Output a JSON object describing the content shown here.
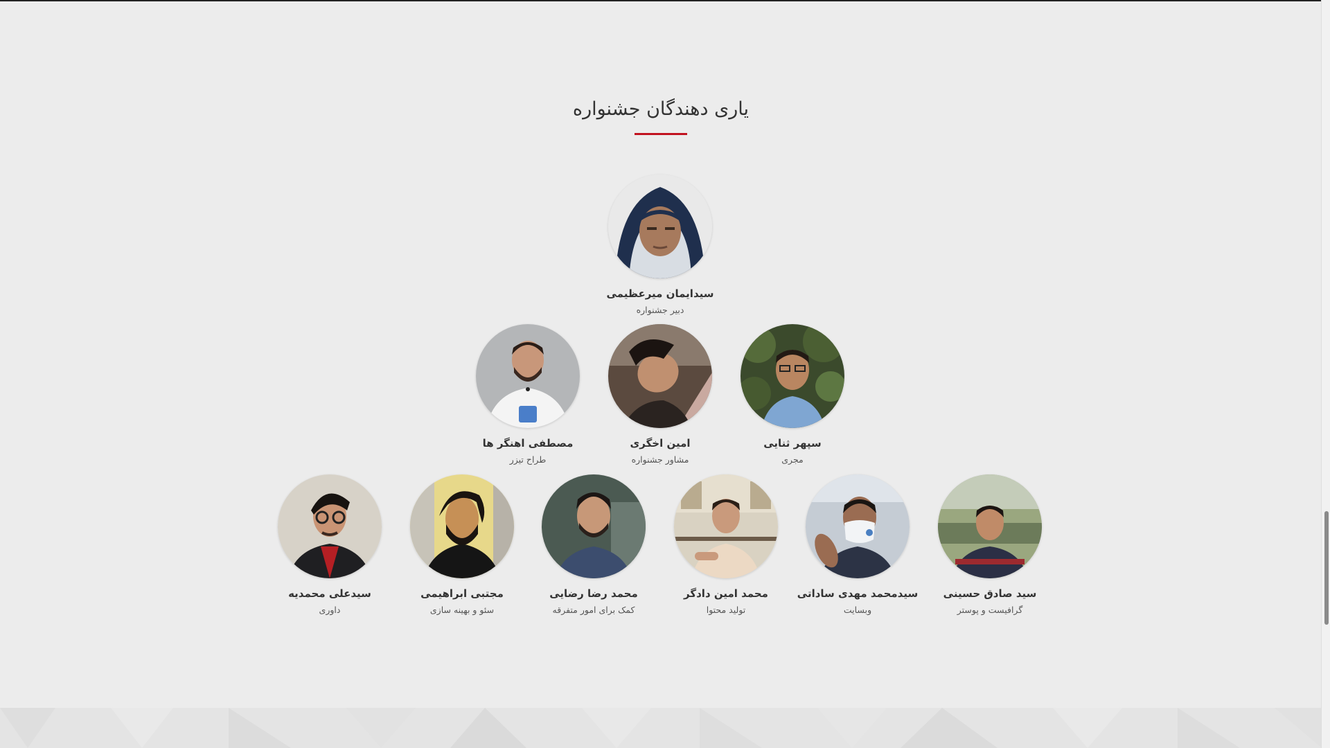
{
  "section": {
    "title": "یاری دهندگان جشنواره"
  },
  "colors": {
    "accent": "#c1121f",
    "background": "#ececec",
    "text": "#333333"
  },
  "members": [
    {
      "name": "سیدایمان میرعظیمی",
      "role": "دبیر جشنواره",
      "photo": "hooded-man-photo"
    },
    {
      "name": "سپهر ثنایی",
      "role": "مجری",
      "photo": "young-man-garden-photo"
    },
    {
      "name": "امین اخگری",
      "role": "مشاور جشنواره",
      "photo": "man-looking-up-photo"
    },
    {
      "name": "مصطفی اهنگر ها",
      "role": "طراح تیزر",
      "photo": "bearded-man-white-shirt-photo"
    },
    {
      "name": "سید صادق حسینی",
      "role": "گرافیست و پوستر",
      "photo": "young-man-striped-sweater-photo"
    },
    {
      "name": "سیدمحمد مهدی ساداتی",
      "role": "وبسایت",
      "photo": "man-face-mask-photo"
    },
    {
      "name": "محمد امین دادگر",
      "role": "تولید محتوا",
      "photo": "young-man-balcony-photo"
    },
    {
      "name": "محمد رضا رضایی",
      "role": "کمک برای امور متفرقه",
      "photo": "young-man-beard-photo"
    },
    {
      "name": "مجتبی ابراهیمی",
      "role": "سئو و بهینه سازی",
      "photo": "stylized-bearded-man-photo"
    },
    {
      "name": "سیدعلی محمدیه",
      "role": "داوری",
      "photo": "man-glasses-suit-photo"
    }
  ]
}
